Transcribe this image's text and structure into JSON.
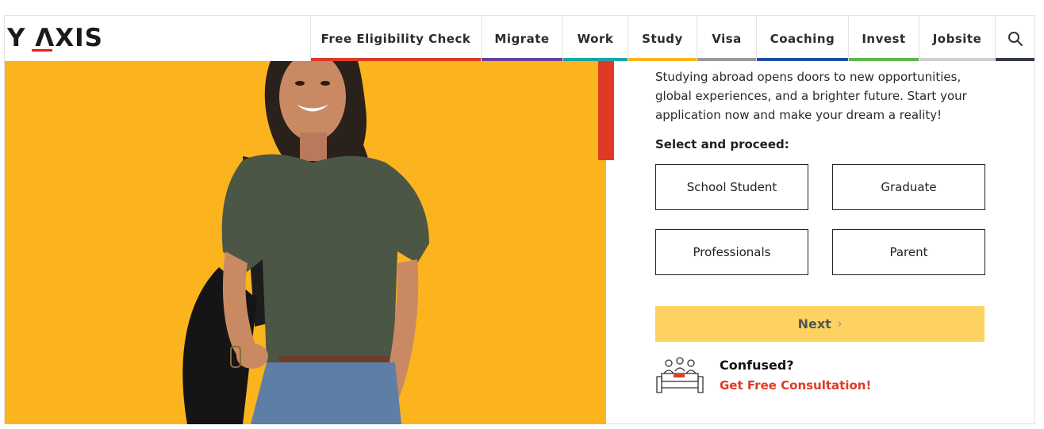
{
  "brand": {
    "logo_text": "Y ΛXIS",
    "accent_color": "#e2231a"
  },
  "nav": {
    "items": [
      {
        "label": "Free Eligibility Check",
        "color": "#e03a26"
      },
      {
        "label": "Migrate",
        "color": "#6b3fa0"
      },
      {
        "label": "Work",
        "color": "#1aa6a6"
      },
      {
        "label": "Study",
        "color": "#fbb41d"
      },
      {
        "label": "Visa",
        "color": "#9a9a9a"
      },
      {
        "label": "Coaching",
        "color": "#1f4fa3"
      },
      {
        "label": "Invest",
        "color": "#5cb84a"
      },
      {
        "label": "Jobsite",
        "color": "#cfcfcf"
      }
    ],
    "search_icon": "search-icon",
    "search_color": "#333a44"
  },
  "hero": {
    "background_color": "#fbb41d",
    "image_subject": "student-with-backpack"
  },
  "panel": {
    "intro": "Studying abroad opens doors to new opportunities, global experiences, and a brighter future. Start your application now and make your dream a reality!",
    "select_label": "Select and proceed:",
    "options": [
      "School Student",
      "Graduate",
      "Professionals",
      "Parent"
    ],
    "next_label": "Next",
    "next_icon": "chevron-right-icon",
    "next_color": "#fdd260",
    "confused_title": "Confused?",
    "consult_link": "Get Free Consultation!",
    "consult_color": "#e03a26"
  }
}
